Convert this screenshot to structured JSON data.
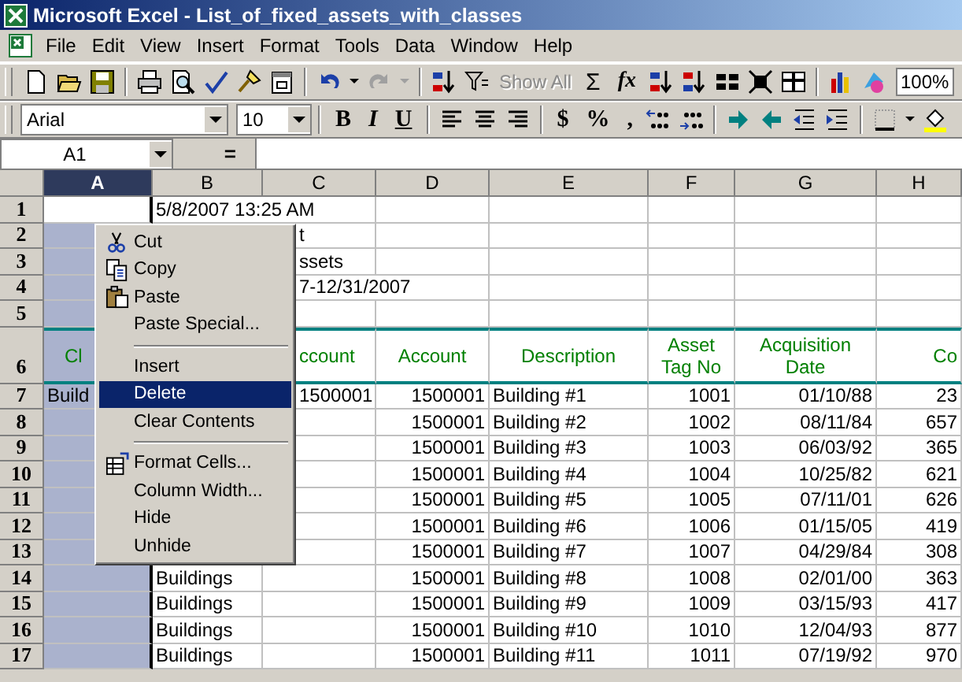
{
  "window": {
    "title": "Microsoft Excel - List_of_fixed_assets_with_classes"
  },
  "menu_bar": [
    "File",
    "Edit",
    "View",
    "Insert",
    "Format",
    "Tools",
    "Data",
    "Window",
    "Help"
  ],
  "standard_toolbar": {
    "show_all": {
      "label": "Show All",
      "disabled": true
    },
    "autosum": "Σ",
    "function": "fx",
    "zoom": "100%"
  },
  "formatting_toolbar": {
    "font": "Arial",
    "size": "10",
    "bold": "B",
    "italic": "I",
    "underline": "U",
    "currency": "$",
    "percent": "%",
    "comma": ","
  },
  "formula_bar": {
    "name_box": "A1",
    "equals": "="
  },
  "sheet": {
    "columns": [
      {
        "label": "A",
        "selected": true
      },
      {
        "label": "B",
        "selected": false
      },
      {
        "label": "C",
        "selected": false
      },
      {
        "label": "D",
        "selected": false
      },
      {
        "label": "E",
        "selected": false
      },
      {
        "label": "F",
        "selected": false
      },
      {
        "label": "G",
        "selected": false
      },
      {
        "label": "H",
        "selected": false
      }
    ],
    "rows": [
      {
        "label": "1",
        "kind": "data",
        "active": true,
        "cells": [
          null,
          "5/8/2007 13:25 AM",
          null,
          null,
          null,
          null,
          null,
          null
        ]
      },
      {
        "label": "2",
        "kind": "data",
        "active": false,
        "cells": [
          null,
          null,
          "t",
          null,
          null,
          null,
          null,
          null
        ]
      },
      {
        "label": "3",
        "kind": "data",
        "active": false,
        "cells": [
          null,
          null,
          "ssets",
          null,
          null,
          null,
          null,
          null
        ]
      },
      {
        "label": "4",
        "kind": "data",
        "active": false,
        "cells": [
          null,
          null,
          "7-12/31/2007",
          null,
          null,
          null,
          null,
          null
        ]
      },
      {
        "label": "5",
        "kind": "data",
        "active": false,
        "cells": [
          null,
          null,
          null,
          null,
          null,
          null,
          null,
          null
        ]
      },
      {
        "label": "6",
        "kind": "header",
        "active": false,
        "cells": [
          "Cl",
          null,
          "ccount",
          "Account",
          "Description",
          "Asset Tag No",
          "Acquisition Date",
          "Co"
        ]
      },
      {
        "label": "7",
        "kind": "data",
        "active": false,
        "cells": [
          "Build",
          null,
          "1500001",
          "1500001",
          "Building #1",
          "1001",
          "01/10/88",
          "23"
        ]
      },
      {
        "label": "8",
        "kind": "data",
        "active": false,
        "cells": [
          null,
          null,
          null,
          "1500001",
          "Building #2",
          "1002",
          "08/11/84",
          "657"
        ]
      },
      {
        "label": "9",
        "kind": "data",
        "active": false,
        "cells": [
          null,
          null,
          null,
          "1500001",
          "Building #3",
          "1003",
          "06/03/92",
          "365"
        ]
      },
      {
        "label": "10",
        "kind": "data",
        "active": false,
        "cells": [
          null,
          null,
          null,
          "1500001",
          "Building #4",
          "1004",
          "10/25/82",
          "621"
        ]
      },
      {
        "label": "11",
        "kind": "data",
        "active": false,
        "cells": [
          null,
          null,
          null,
          "1500001",
          "Building #5",
          "1005",
          "07/11/01",
          "626"
        ]
      },
      {
        "label": "12",
        "kind": "data",
        "active": false,
        "cells": [
          null,
          null,
          null,
          "1500001",
          "Building #6",
          "1006",
          "01/15/05",
          "419"
        ]
      },
      {
        "label": "13",
        "kind": "data",
        "active": false,
        "cells": [
          null,
          null,
          null,
          "1500001",
          "Building #7",
          "1007",
          "04/29/84",
          "308"
        ]
      },
      {
        "label": "14",
        "kind": "data",
        "active": false,
        "cells": [
          null,
          "Buildings",
          null,
          "1500001",
          "Building #8",
          "1008",
          "02/01/00",
          "363"
        ]
      },
      {
        "label": "15",
        "kind": "data",
        "active": false,
        "cells": [
          null,
          "Buildings",
          null,
          "1500001",
          "Building #9",
          "1009",
          "03/15/93",
          "417"
        ]
      },
      {
        "label": "16",
        "kind": "data",
        "active": false,
        "cells": [
          null,
          "Buildings",
          null,
          "1500001",
          "Building #10",
          "1010",
          "12/04/93",
          "877"
        ]
      },
      {
        "label": "17",
        "kind": "data",
        "active": false,
        "cells": [
          null,
          "Buildings",
          null,
          "1500001",
          "Building #11",
          "1011",
          "07/19/92",
          "970"
        ]
      }
    ]
  },
  "context_menu": [
    {
      "kind": "cut",
      "label": "Cut",
      "selected": false
    },
    {
      "kind": "copy",
      "label": "Copy",
      "selected": false
    },
    {
      "kind": "paste",
      "label": "Paste",
      "selected": false
    },
    {
      "kind": "plain",
      "label": "Paste Special...",
      "selected": false
    },
    {
      "kind": "separator"
    },
    {
      "kind": "plain",
      "label": "Insert",
      "selected": false
    },
    {
      "kind": "plain",
      "label": "Delete",
      "selected": true
    },
    {
      "kind": "plain",
      "label": "Clear Contents",
      "selected": false
    },
    {
      "kind": "separator"
    },
    {
      "kind": "format",
      "label": "Format Cells...",
      "selected": false
    },
    {
      "kind": "plain",
      "label": "Column Width...",
      "selected": false
    },
    {
      "kind": "plain",
      "label": "Hide",
      "selected": false
    },
    {
      "kind": "plain",
      "label": "Unhide",
      "selected": false
    }
  ]
}
